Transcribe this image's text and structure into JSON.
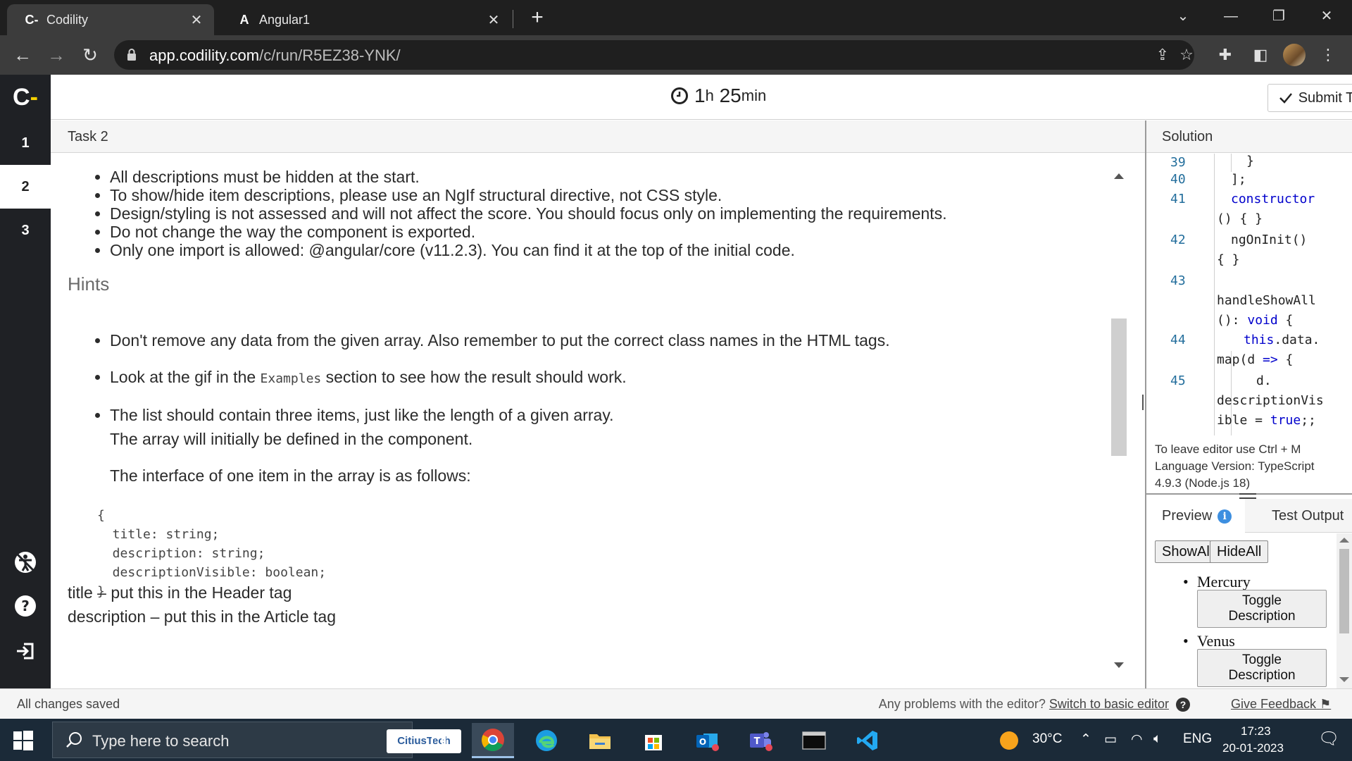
{
  "browser": {
    "tabs": [
      {
        "label": "Codility",
        "favicon": "C-"
      },
      {
        "label": "Angular1",
        "favicon": "A"
      }
    ],
    "url_host": "app.codility.com",
    "url_path": "/c/run/R5EZ38-YNK/"
  },
  "app": {
    "logo": "C",
    "logo_accent": "-",
    "timer_hours": "1",
    "timer_h": "h",
    "timer_minutes": "25",
    "timer_min": "min",
    "submit_label": "Submit Task",
    "rail_items": [
      "1",
      "2",
      "3"
    ]
  },
  "task": {
    "title": "Task 2",
    "requirements": [
      "All descriptions must be hidden at the start.",
      "To show/hide item descriptions, please use an NgIf structural directive, not CSS style.",
      "Design/styling is not assessed and will not affect the score. You should focus only on implementing the requirements.",
      "Do not change the way the component is exported.",
      "Only one import is allowed: @angular/core (v11.2.3). You can find it at the top of the initial code."
    ],
    "hints_heading": "Hints",
    "hint1": "Don't remove any data from the given array. Also remember to put the correct class names in the HTML tags.",
    "hint2_pre": "Look at the gif in the",
    "hint2_code": "Examples",
    "hint2_post": "section to see how the result should work.",
    "hint3": "The list should contain three items, just like the length of a given array.",
    "hint3_cont": "The array will initially be defined in the component.",
    "interface_intro": "The interface of one item in the array is as follows:",
    "interface_code": "{\n  title: string;\n  description: string;\n  descriptionVisible: boolean;\n}",
    "title_note": "title – put this in the Header tag",
    "description_note": "description – put this in the Article tag"
  },
  "solution": {
    "title": "Solution",
    "line_numbers": [
      "39",
      "40",
      "41",
      "42",
      "43",
      "44",
      "45"
    ],
    "code": {
      "l39": "}",
      "l40": "];",
      "l41a": "constructor",
      "l41b": "() { }",
      "l42a": "ngOnInit()",
      "l42b": "{ }",
      "l43": "handleShowAll",
      "l43b_punct": "(): ",
      "l43b_kw": "void",
      "l43b_brace": " {",
      "l44a_kw": "this",
      "l44a_rest": ".data.",
      "l44b_map": "map(d ",
      "l44b_arrow": "=>",
      "l44b_brace": " {",
      "l45a": "d.",
      "l45b": "descriptionVis",
      "l45c_text": "ible = ",
      "l45c_kw": "true",
      "l45c_end": ";;"
    },
    "footer_line1": "To leave editor use Ctrl + M",
    "footer_line2": "Language Version: TypeScript",
    "footer_line3": "4.9.3 (Node.js 18)",
    "preview_tab": "Preview",
    "info_glyph": "i",
    "test_output_tab": "Test Output",
    "show_all": "ShowAll",
    "hide_all": "HideAll",
    "planets": [
      "Mercury",
      "Venus"
    ],
    "toggle_line1": "Toggle",
    "toggle_line2": "Description"
  },
  "statusbar": {
    "saved": "All changes saved",
    "problems": "Any problems with the editor?",
    "switch_link": "Switch to basic editor",
    "help_glyph": "?",
    "feedback": "Give Feedback"
  },
  "taskbar": {
    "search_placeholder": "Type here to search",
    "pinned_label": "CitiusTech",
    "temperature": "30°C",
    "language": "ENG",
    "time": "17:23",
    "date": "20-01-2023"
  },
  "colors": {
    "accent_yellow": "#f5d000",
    "rail_bg": "#1f2125",
    "link_blue": "#3d8fe0"
  }
}
